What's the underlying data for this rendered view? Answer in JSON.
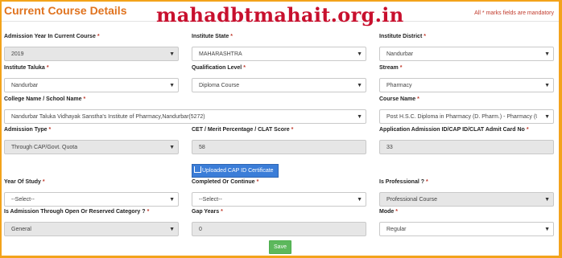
{
  "header": {
    "title": "Current Course Details",
    "watermark": "mahadbtmahait.org.in",
    "mandatory_note": "All * marks fields are mandatory"
  },
  "fields": [
    {
      "label": "Admission Year In Current Course",
      "value": "2019",
      "type": "select",
      "disabled": true
    },
    {
      "label": "Institute State",
      "value": "MAHARASHTRA",
      "type": "select",
      "disabled": false
    },
    {
      "label": "Institute District",
      "value": "Nandurbar",
      "type": "select",
      "disabled": false
    },
    {
      "label": "Institute Taluka",
      "value": "Nandurbar",
      "type": "select",
      "disabled": false
    },
    {
      "label": "Qualification Level",
      "value": "Diploma Course",
      "type": "select",
      "disabled": false
    },
    {
      "label": "Stream",
      "value": "Pharmacy",
      "type": "select",
      "disabled": false
    },
    {
      "label": "College Name / School Name",
      "value": "Nandurbar Taluka Vidhayak Sanstha's Institute of Pharmacy,Nandurbar(5272)",
      "type": "select",
      "disabled": false
    },
    {
      "label": "Course Name",
      "value": "Post H.S.C. Diploma in Pharmacy (D. Pharm.) - Pharmacy (UnAid",
      "type": "select",
      "disabled": false
    },
    {
      "label": "Admission Type",
      "value": "Through CAP/Govt. Quota",
      "type": "select",
      "disabled": true
    },
    {
      "label": "CET / Merit Percentage / CLAT Score",
      "value": "58",
      "type": "input",
      "disabled": true
    },
    {
      "label": "Application Admission ID/CAP ID/CLAT Admit Card No",
      "value": "33",
      "type": "input",
      "disabled": true
    },
    {
      "label": "Year Of Study",
      "value": "--Select--",
      "type": "select",
      "disabled": false
    },
    {
      "label": "Completed Or Continue",
      "value": "--Select--",
      "type": "select",
      "disabled": false
    },
    {
      "label": "Is Professional ?",
      "value": "Professional Course",
      "type": "select",
      "disabled": true
    },
    {
      "label": "Is Admission Through Open Or Reserved Category ?",
      "value": "General",
      "type": "select",
      "disabled": true
    },
    {
      "label": "Gap Years",
      "value": "0",
      "type": "input",
      "disabled": true
    },
    {
      "label": "Mode",
      "value": "Regular",
      "type": "select",
      "disabled": false
    }
  ],
  "required_mark": "*",
  "dropdown_arrow": "▼",
  "upload_button": {
    "label": "Uploaded CAP ID Certificate",
    "icon": "upload-icon"
  },
  "save_button": {
    "label": "Save"
  },
  "colors": {
    "border": "#f3a31b",
    "title": "#e0731f",
    "required": "#c0392b",
    "watermark": "#c8102e",
    "upload": "#3b7dd8",
    "save": "#5cb85c"
  }
}
